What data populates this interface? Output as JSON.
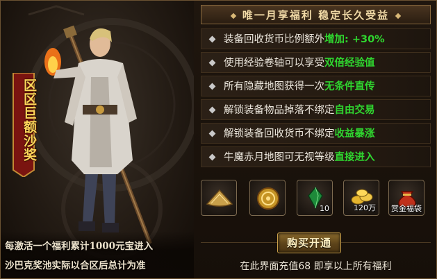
{
  "left": {
    "banner_text": "区区巨额沙奖",
    "promo_line1": "每激活一个福利累计1000元宝进入",
    "promo_line2": "沙巴克奖池实际以合区后总计为准"
  },
  "right": {
    "title": "唯一月享福利 稳定长久受益",
    "benefits": [
      {
        "text": "装备回收货币比例额外",
        "highlight": "增加: +30%"
      },
      {
        "text": "使用经验卷轴可以享受",
        "highlight": "双倍经验值"
      },
      {
        "text": "所有隐藏地图获得一次",
        "highlight": "无条件直传"
      },
      {
        "text": "解锁装备物品掉落不绑定",
        "highlight": "自由交易"
      },
      {
        "text": "解锁装备回收货币不绑定",
        "highlight": "收益暴涨"
      },
      {
        "text": "牛魔赤月地图可无视等级",
        "highlight": "直接进入"
      }
    ],
    "items": [
      {
        "icon": "hat-icon",
        "qty": ""
      },
      {
        "icon": "gold-medal-icon",
        "qty": ""
      },
      {
        "icon": "green-gem-icon",
        "qty": "10"
      },
      {
        "icon": "gold-pile-icon",
        "qty": "120万"
      },
      {
        "icon": "lucky-bag-icon",
        "label": "赏金福袋"
      }
    ],
    "buy_button": "购买开通",
    "footer": "在此界面充值68 即享以上所有福利"
  },
  "colors": {
    "highlight": "#2fd52f",
    "title_text": "#f0d9a6",
    "banner_text": "#ffd65a"
  }
}
